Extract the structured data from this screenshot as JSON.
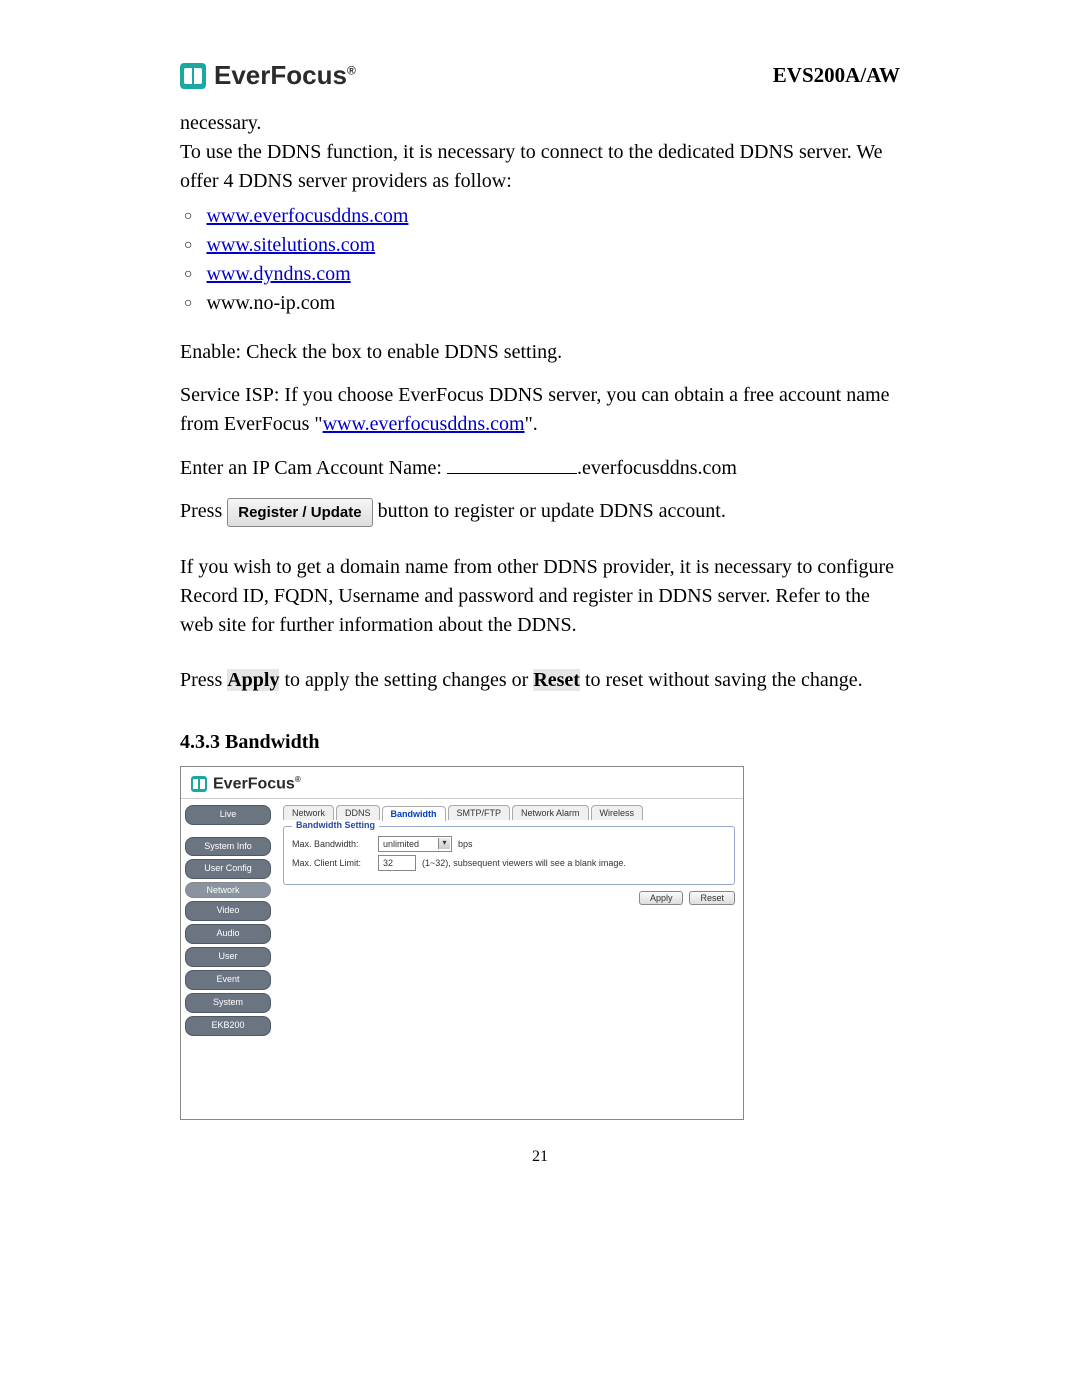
{
  "header": {
    "brand": "EverFocus",
    "model": "EVS200A/AW"
  },
  "body": {
    "p1a": "necessary.",
    "p1b": "To use the DDNS function, it is necessary to connect to the dedicated DDNS server. We offer 4 DDNS server providers as follow:",
    "links": {
      "l1": "www.everfocusddns.com",
      "l2": "www.sitelutions.com",
      "l3": "www.dyndns.com",
      "l4": "www.no-ip.com"
    },
    "p2": "Enable: Check the box to enable DDNS setting.",
    "p3a": "Service ISP: If you choose EverFocus DDNS server, you can obtain a free account name from EverFocus \"",
    "p3_link": "www.everfocusddns.com",
    "p3b": "\".",
    "p4a": "Enter an IP Cam Account Name: ",
    "p4b": ".everfocusddns.com",
    "p5a": "Press ",
    "p5_btn": "Register / Update",
    "p5b": " button to register or update DDNS account.",
    "p6": "If you wish to get a domain name from other DDNS provider, it is necessary to configure Record ID, FQDN, Username and password and register in DDNS server. Refer to the web site for further information about the DDNS.",
    "p7a": "Press ",
    "p7_apply": "Apply",
    "p7b": " to apply the setting changes or ",
    "p7_reset": "Reset",
    "p7c": " to reset without saving the change."
  },
  "section": {
    "num_title": "4.3.3 Bandwidth"
  },
  "ui": {
    "brand": "EverFocus",
    "side": {
      "live": "Live",
      "sysinfo": "System Info",
      "userconfig": "User Config",
      "network": "Network",
      "video": "Video",
      "audio": "Audio",
      "user": "User",
      "event": "Event",
      "system": "System",
      "ekb": "EKB200"
    },
    "tabs": {
      "network": "Network",
      "ddns": "DDNS",
      "bandwidth": "Bandwidth",
      "smtpftp": "SMTP/FTP",
      "netalarm": "Network Alarm",
      "wireless": "Wireless"
    },
    "fieldset": {
      "legend": "Bandwidth Setting",
      "maxbw_label": "Max. Bandwidth:",
      "maxbw_value": "unlimited",
      "bps": "bps",
      "maxclient_label": "Max. Client Limit:",
      "maxclient_value": "32",
      "maxclient_hint": "(1~32), subsequent viewers will see a blank image."
    },
    "buttons": {
      "apply": "Apply",
      "reset": "Reset"
    }
  },
  "page_number": "21"
}
